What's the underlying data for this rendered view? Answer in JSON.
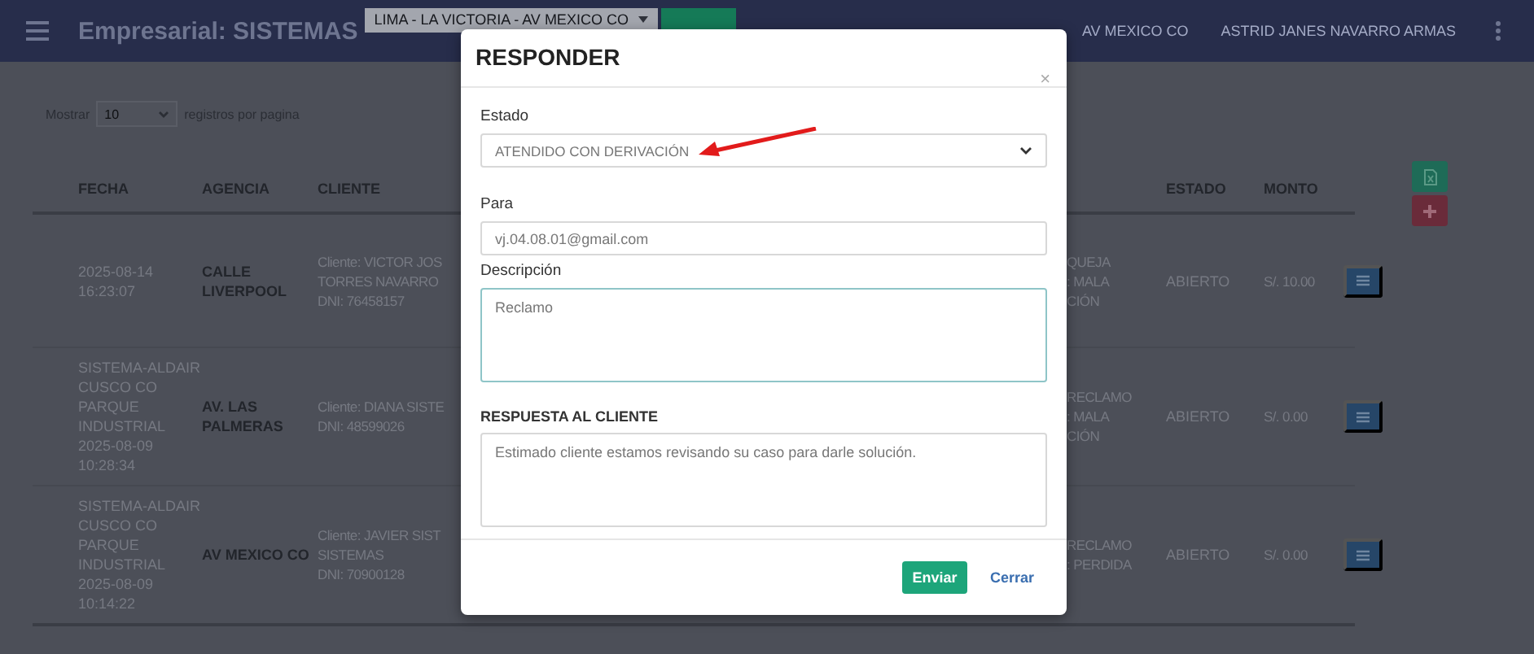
{
  "header": {
    "title": "Empresarial: SISTEMAS",
    "branch_select": "LIMA - LA VICTORIA - AV MEXICO CO",
    "agency": "AV MEXICO CO",
    "user": "ASTRID JANES NAVARRO ARMAS"
  },
  "page_length": {
    "prefix": "Mostrar",
    "value": "10",
    "suffix": "registros por pagina"
  },
  "table": {
    "columns": [
      "FECHA",
      "AGENCIA",
      "CLIENTE",
      "ESTADO",
      "MONTO"
    ],
    "rows": [
      {
        "fecha": "2025-08-14\n16:23:07",
        "agencia": "CALLE\nLIVERPOOL",
        "cliente": "Cliente: VICTOR JOS\nTORRES NAVARRO\nDNI: 76458157",
        "column_4": "QUEJA\n: MALA\nCIÓN",
        "estado": "ABIERTO",
        "monto": "S/. 10.00"
      },
      {
        "fecha": "SISTEMA-ALDAIR\nCUSCO CO\nPARQUE\nINDUSTRIAL\n2025-08-09\n10:28:34",
        "agencia": "AV. LAS\nPALMERAS",
        "cliente": "Cliente: DIANA SISTE\nDNI: 48599026",
        "column_4": "RECLAMO\n: MALA\nCIÓN",
        "estado": "ABIERTO",
        "monto": "S/. 0.00"
      },
      {
        "fecha": "SISTEMA-ALDAIR\nCUSCO CO\nPARQUE\nINDUSTRIAL\n2025-08-09\n10:14:22",
        "agencia": "AV MEXICO CO",
        "cliente": "Cliente: JAVIER SIST\nSISTEMAS\nDNI: 70900128",
        "column_4": "RECLAMO\n: PERDIDA",
        "estado": "ABIERTO",
        "monto": "S/. 0.00"
      }
    ]
  },
  "modal": {
    "title": "RESPONDER",
    "close": "×",
    "fields": [
      {
        "label": "Estado",
        "kind": "select",
        "value": "ATENDIDO CON DERIVACIÓN",
        "focused": false,
        "emphasized": false
      },
      {
        "label": "Para",
        "kind": "input",
        "value": "vj.04.08.01@gmail.com",
        "focused": false,
        "emphasized": false
      },
      {
        "label": "Descripción",
        "kind": "textarea",
        "value": "Reclamo",
        "focused": true,
        "emphasized": false
      },
      {
        "label": "RESPUESTA AL CLIENTE",
        "kind": "textarea",
        "value": "Estimado cliente estamos revisando su caso para darle solución.",
        "focused": false,
        "emphasized": true
      }
    ],
    "buttons": [
      {
        "label": "Enviar",
        "kind": "primary"
      },
      {
        "label": "Cerrar",
        "kind": "link"
      }
    ]
  }
}
